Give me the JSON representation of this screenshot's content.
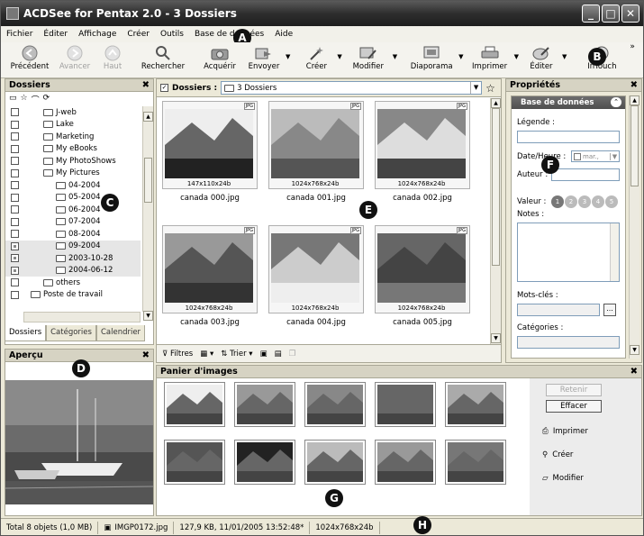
{
  "window": {
    "title": "ACDSee for Pentax 2.0 - 3 Dossiers"
  },
  "menu": [
    "Fichier",
    "Éditer",
    "Affichage",
    "Créer",
    "Outils",
    "Base de données",
    "Aide"
  ],
  "toolbar": {
    "precedent": "Précédent",
    "avancer": "Avancer",
    "haut": "Haut",
    "rechercher": "Rechercher",
    "acquerir": "Acquérir",
    "envoyer": "Envoyer",
    "creer": "Créer",
    "modifier": "Modifier",
    "diaporama": "Diaporama",
    "imprimer": "Imprimer",
    "editer": "Éditer",
    "intouch": "InTouch"
  },
  "callouts": {
    "a": "A",
    "b": "B",
    "c": "C",
    "d": "D",
    "e": "E",
    "f": "F",
    "g": "G",
    "h": "H"
  },
  "folders_panel": {
    "title": "Dossiers",
    "tree": [
      {
        "label": "J-web",
        "indent": 1,
        "partial": false,
        "sel": false
      },
      {
        "label": "Lake",
        "indent": 1,
        "partial": false,
        "sel": false
      },
      {
        "label": "Marketing",
        "indent": 1,
        "partial": false,
        "sel": false
      },
      {
        "label": "My eBooks",
        "indent": 1,
        "partial": false,
        "sel": false
      },
      {
        "label": "My PhotoShows",
        "indent": 1,
        "partial": false,
        "sel": false
      },
      {
        "label": "My Pictures",
        "indent": 1,
        "partial": false,
        "sel": false
      },
      {
        "label": "04-2004",
        "indent": 2,
        "partial": false,
        "sel": false
      },
      {
        "label": "05-2004",
        "indent": 2,
        "partial": false,
        "sel": false
      },
      {
        "label": "06-2004",
        "indent": 2,
        "partial": false,
        "sel": false
      },
      {
        "label": "07-2004",
        "indent": 2,
        "partial": false,
        "sel": false
      },
      {
        "label": "08-2004",
        "indent": 2,
        "partial": false,
        "sel": false
      },
      {
        "label": "09-2004",
        "indent": 2,
        "partial": true,
        "sel": true
      },
      {
        "label": "2003-10-28",
        "indent": 2,
        "partial": true,
        "sel": true
      },
      {
        "label": "2004-06-12",
        "indent": 2,
        "partial": true,
        "sel": true
      },
      {
        "label": "others",
        "indent": 1,
        "partial": false,
        "sel": false
      },
      {
        "label": "Poste de travail",
        "indent": 0,
        "partial": false,
        "sel": false
      }
    ],
    "tabs": [
      "Dossiers",
      "Catégories",
      "Calendrier"
    ]
  },
  "apercu": {
    "title": "Aperçu"
  },
  "browser": {
    "label": "Dossiers :",
    "path": "3 Dossiers",
    "thumbs": [
      {
        "name": "canada 000.jpg",
        "dims": "147x110x24b",
        "badge": "JPG"
      },
      {
        "name": "canada 001.jpg",
        "dims": "1024x768x24b",
        "badge": "JPG"
      },
      {
        "name": "canada 002.jpg",
        "dims": "1024x768x24b",
        "badge": "JPG"
      },
      {
        "name": "canada 003.jpg",
        "dims": "1024x768x24b",
        "badge": "JPG"
      },
      {
        "name": "canada 004.jpg",
        "dims": "1024x768x24b",
        "badge": "JPG"
      },
      {
        "name": "canada 005.jpg",
        "dims": "1024x768x24b",
        "badge": "JPG"
      }
    ],
    "filtres": "Filtres",
    "trier": "Trier"
  },
  "props": {
    "title": "Propriétés",
    "section": "Base de données",
    "legende": "Légende :",
    "date": "Date/Heure :",
    "date_value": "mar.,",
    "auteur": "Auteur :",
    "valeur": "Valeur :",
    "rating": [
      "1",
      "2",
      "3",
      "4",
      "5"
    ],
    "notes": "Notes :",
    "motscles": "Mots-clés :",
    "more": "...",
    "categories": "Catégories :"
  },
  "basket": {
    "title": "Panier d'images",
    "retenir": "Retenir",
    "effacer": "Effacer",
    "imprimer": "Imprimer",
    "creer": "Créer",
    "modifier": "Modifier"
  },
  "status": {
    "total": "Total 8 objets (1,0 MB)",
    "file": "IMGP0172.jpg",
    "info": "127,9 KB, 11/01/2005 13:52:48*",
    "dims": "1024x768x24b"
  }
}
